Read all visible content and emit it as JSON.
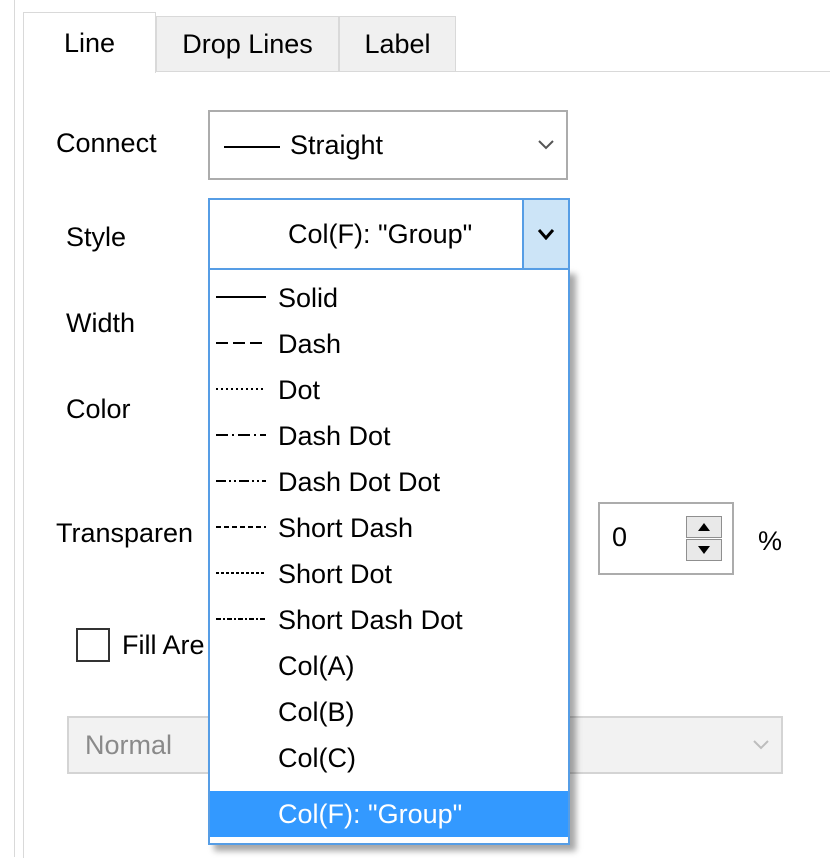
{
  "tabs": [
    {
      "label": "Line",
      "active": true
    },
    {
      "label": "Drop Lines",
      "active": false
    },
    {
      "label": "Label",
      "active": false
    }
  ],
  "connect": {
    "label": "Connect",
    "value": "Straight"
  },
  "style": {
    "label": "Style",
    "value": "Col(F): \"Group\""
  },
  "width": {
    "label": "Width"
  },
  "color": {
    "label": "Color"
  },
  "transparency": {
    "label": "Transparen",
    "value": "0",
    "unit": "%"
  },
  "fill_area": {
    "label": "Fill Are",
    "checked": false
  },
  "fill_mode": {
    "value": "Normal"
  },
  "style_options": [
    {
      "label": "Solid",
      "pattern": "solid"
    },
    {
      "label": "Dash",
      "pattern": "dash"
    },
    {
      "label": "Dot",
      "pattern": "dot"
    },
    {
      "label": "Dash Dot",
      "pattern": "dash-dot"
    },
    {
      "label": "Dash Dot Dot",
      "pattern": "dash-dot-dot"
    },
    {
      "label": "Short Dash",
      "pattern": "short-dash"
    },
    {
      "label": "Short Dot",
      "pattern": "short-dot"
    },
    {
      "label": "Short Dash Dot",
      "pattern": "short-dash-dot"
    },
    {
      "label": "Col(A)",
      "pattern": "none"
    },
    {
      "label": "Col(B)",
      "pattern": "none"
    },
    {
      "label": "Col(C)",
      "pattern": "none"
    },
    {
      "label": "Col(F): \"Group\"",
      "pattern": "none",
      "selected": true
    }
  ],
  "colors": {
    "accent": "#569de5",
    "selection": "#3399ff",
    "dropbtn": "#cce4f7"
  }
}
